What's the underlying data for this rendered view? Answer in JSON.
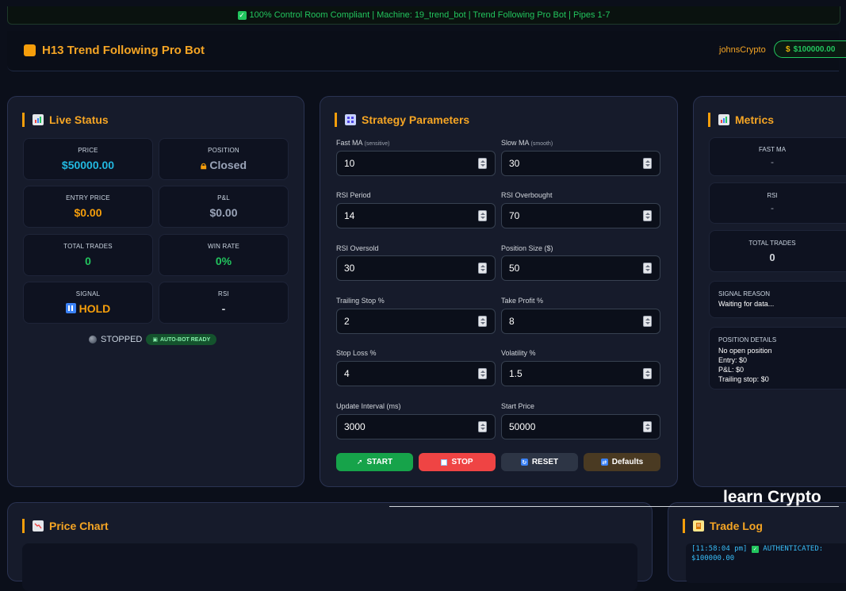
{
  "banner": {
    "text": "100% Control Room Compliant | Machine: 19_trend_bot | Trend Following Pro Bot | Pipes 1-7"
  },
  "header": {
    "title": "H13 Trend Following Pro Bot",
    "user": "johnsCrypto",
    "balance": "$100000.00"
  },
  "live_status": {
    "title": "Live Status",
    "tiles": [
      {
        "label": "PRICE",
        "value": "$50000.00",
        "color": "#22b8e0"
      },
      {
        "label": "POSITION",
        "value": "Closed",
        "color": "#9aa4b8",
        "icon": "lock-icon"
      },
      {
        "label": "ENTRY PRICE",
        "value": "$0.00",
        "color": "#f59e0b"
      },
      {
        "label": "P&L",
        "value": "$0.00",
        "color": "#9aa4b8"
      },
      {
        "label": "TOTAL TRADES",
        "value": "0",
        "color": "#22c55e"
      },
      {
        "label": "WIN RATE",
        "value": "0%",
        "color": "#22c55e"
      },
      {
        "label": "SIGNAL",
        "value": "HOLD",
        "color": "#f59e0b",
        "icon": "pause-icon"
      },
      {
        "label": "RSI",
        "value": "-",
        "color": "#d1d5db"
      }
    ],
    "state": "STOPPED",
    "auto_bot_badge": "AUTO-BOT READY"
  },
  "strategy": {
    "title": "Strategy Parameters",
    "params": [
      {
        "label": "Fast MA",
        "hint": "(sensitive)",
        "value": "10"
      },
      {
        "label": "Slow MA",
        "hint": "(smooth)",
        "value": "30"
      },
      {
        "label": "RSI Period",
        "hint": "",
        "value": "14"
      },
      {
        "label": "RSI Overbought",
        "hint": "",
        "value": "70"
      },
      {
        "label": "RSI Oversold",
        "hint": "",
        "value": "30"
      },
      {
        "label": "Position Size ($)",
        "hint": "",
        "value": "50"
      },
      {
        "label": "Trailing Stop %",
        "hint": "",
        "value": "2"
      },
      {
        "label": "Take Profit %",
        "hint": "",
        "value": "8"
      },
      {
        "label": "Stop Loss %",
        "hint": "",
        "value": "4"
      },
      {
        "label": "Volatility %",
        "hint": "",
        "value": "1.5"
      },
      {
        "label": "Update Interval (ms)",
        "hint": "",
        "value": "3000"
      },
      {
        "label": "Start Price",
        "hint": "",
        "value": "50000"
      }
    ],
    "buttons": {
      "start": "START",
      "stop": "STOP",
      "reset": "RESET",
      "defaults": "Defaults"
    }
  },
  "metrics": {
    "title": "Metrics",
    "fast_ma": {
      "label": "FAST MA",
      "value": "-"
    },
    "rsi": {
      "label": "RSI",
      "value": "-"
    },
    "total_trades": {
      "label": "TOTAL TRADES",
      "value": "0"
    },
    "signal_reason": {
      "label": "SIGNAL REASON",
      "value": "Waiting for data..."
    },
    "position_details": {
      "label": "POSITION DETAILS",
      "lines": [
        "No open position",
        "Entry: $0",
        "P&L: $0",
        "Trailing stop: $0"
      ]
    }
  },
  "price_chart": {
    "title": "Price Chart"
  },
  "trade_log": {
    "title": "Trade Log",
    "entry_time": "[11:58:04 pm]",
    "entry_text": "AUTHENTICATED:",
    "entry_cont": "$100000.00"
  },
  "watermark": "learn Crypto"
}
